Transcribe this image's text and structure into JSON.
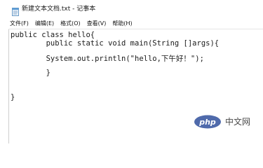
{
  "window": {
    "title": "新建文本文档.txt - 记事本",
    "icon": "notepad-icon"
  },
  "menu": [
    {
      "label": "文件(F)"
    },
    {
      "label": "编辑(E)"
    },
    {
      "label": "格式(O)"
    },
    {
      "label": "查看(V)"
    },
    {
      "label": "帮助(H)"
    }
  ],
  "editor": {
    "lines": [
      "public class hello{",
      "        public static void main(String []args){",
      "        System.out.println(\"hello,下午好！\");",
      "        }",
      "}"
    ]
  },
  "watermark": {
    "logo_text": "php",
    "text": "中文网",
    "logo_color": "#4f6aab"
  }
}
